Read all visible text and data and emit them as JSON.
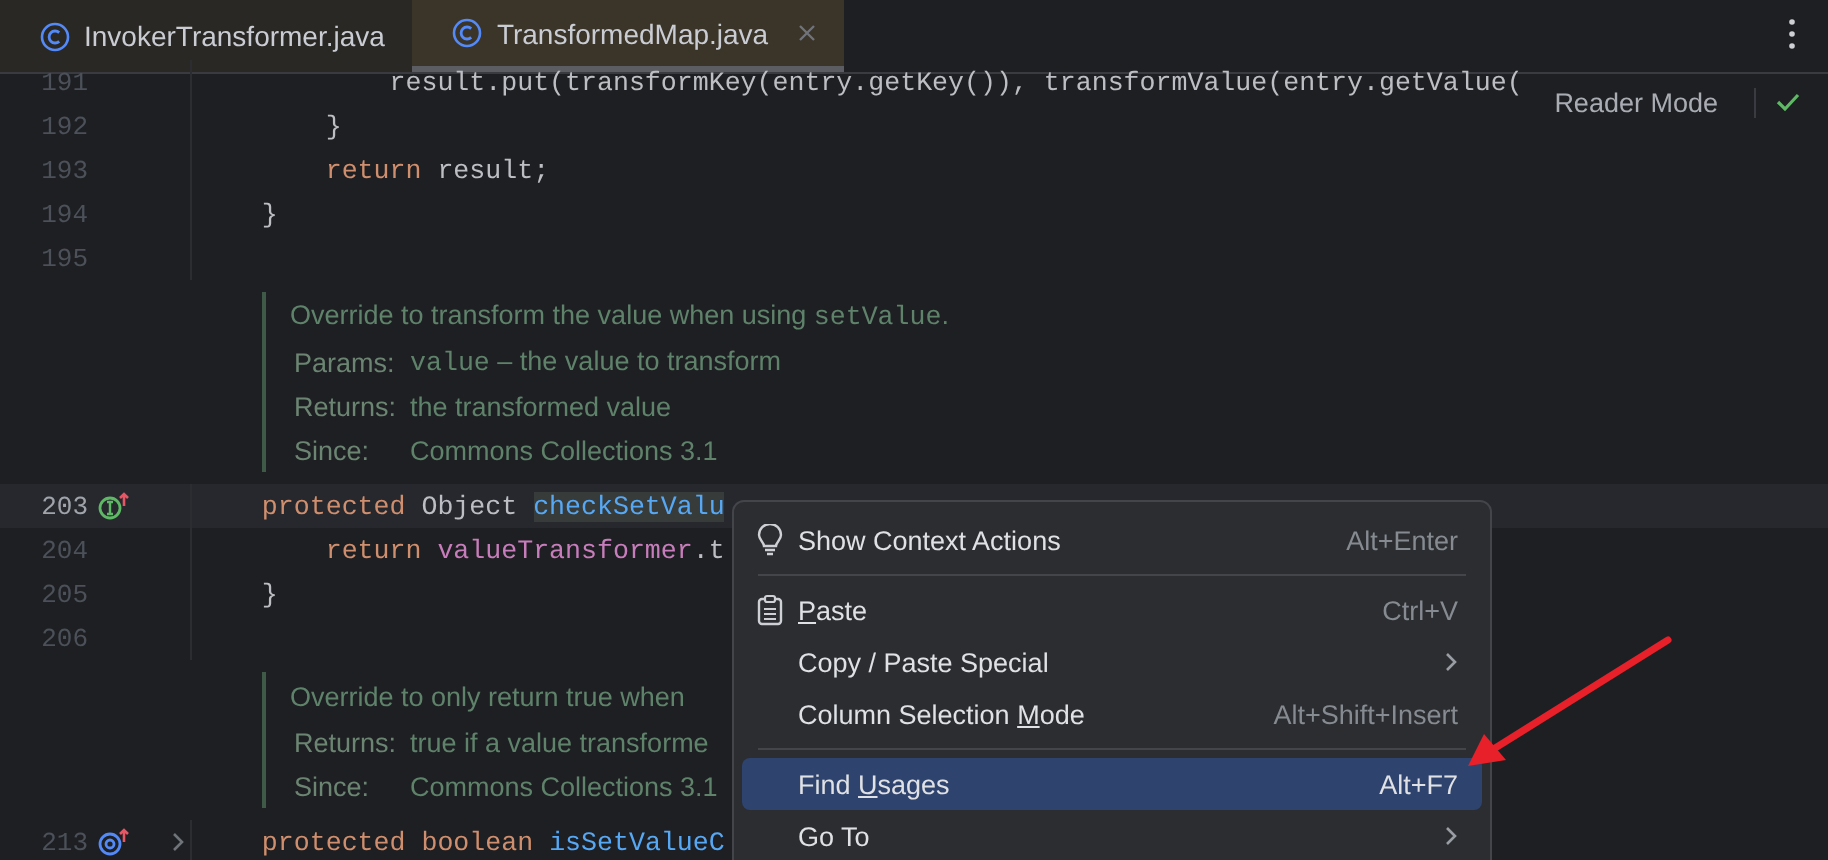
{
  "tabs": [
    {
      "label": "InvokerTransformer.java",
      "selected": false,
      "closable": false
    },
    {
      "label": "TransformedMap.java",
      "selected": true,
      "closable": true
    }
  ],
  "reader_mode": {
    "label": "Reader Mode"
  },
  "editor": {
    "lines": [
      {
        "kind": "code",
        "number": "191",
        "current": false,
        "tokens": [
          {
            "text": "            result.put(transformKey(entry.getKey()), transformValue(entry.getValue("
          }
        ]
      },
      {
        "kind": "code",
        "number": "192",
        "current": false,
        "tokens": [
          {
            "text": "        }"
          }
        ]
      },
      {
        "kind": "code",
        "number": "193",
        "current": false,
        "tokens": [
          {
            "text": "        return",
            "kind": "keyword"
          },
          {
            "text": " result;"
          }
        ]
      },
      {
        "kind": "code",
        "number": "194",
        "current": false,
        "tokens": [
          {
            "text": "    }"
          }
        ]
      },
      {
        "kind": "code",
        "number": "195",
        "current": false
      },
      {
        "kind": "doc",
        "rows": [
          {
            "kind": "summary",
            "parts": [
              {
                "text": "Override to transform the value when using "
              },
              {
                "text": "setValue",
                "kind": "code"
              },
              {
                "text": "."
              }
            ]
          },
          {
            "kind": "tag",
            "tag": "Params:",
            "parts": [
              {
                "text": "value",
                "kind": "code"
              },
              {
                "text": " – the value to transform"
              }
            ]
          },
          {
            "kind": "tag",
            "tag": "Returns:",
            "parts": [
              {
                "text": "the transformed value"
              }
            ]
          },
          {
            "kind": "tag",
            "tag": "Since:",
            "parts": [
              {
                "text": "Commons Collections 3.1"
              }
            ]
          }
        ]
      },
      {
        "kind": "overriding",
        "number": "203",
        "current": true,
        "tokens": [
          {
            "text": "    protected",
            "kind": "keyword"
          },
          {
            "text": " Object "
          },
          {
            "text": "checkSetValu",
            "kind": "selection"
          }
        ]
      },
      {
        "kind": "code",
        "number": "204",
        "current": false,
        "tokens": [
          {
            "text": "        return ",
            "kind": "keyword"
          },
          {
            "text": "valueTransformer",
            "kind": "field"
          },
          {
            "text": ".t"
          }
        ]
      },
      {
        "kind": "code",
        "number": "205",
        "current": false,
        "tokens": [
          {
            "text": "    }"
          }
        ]
      },
      {
        "kind": "code",
        "number": "206",
        "current": false
      },
      {
        "kind": "doc",
        "rows": [
          {
            "kind": "summary",
            "parts": [
              {
                "text": "Override to only return true when"
              }
            ]
          },
          {
            "kind": "tag",
            "tag": "Returns:",
            "parts": [
              {
                "text": "true if a value transforme"
              }
            ]
          },
          {
            "kind": "tag",
            "tag": "Since:",
            "parts": [
              {
                "text": "Commons Collections 3.1"
              }
            ]
          }
        ]
      },
      {
        "kind": "implemented",
        "number": "213",
        "current": false,
        "foldable": true,
        "tokens": [
          {
            "text": "    protected boolean ",
            "kind": "keyword"
          },
          {
            "text": "isSetValueC",
            "kind": "declaration"
          }
        ]
      }
    ]
  },
  "context_menu": {
    "items": [
      {
        "kind": "intention",
        "parts": [
          {
            "text": "Show Context Actions"
          }
        ],
        "shortcut": "Alt+Enter",
        "selected": false
      },
      {
        "kind": "separator"
      },
      {
        "kind": "paste",
        "parts": [
          {
            "text": "P",
            "underline": true
          },
          {
            "text": "aste"
          }
        ],
        "shortcut": "Ctrl+V",
        "selected": false
      },
      {
        "kind": "submenu",
        "parts": [
          {
            "text": "Copy / Paste Special"
          }
        ],
        "selected": false
      },
      {
        "kind": "action",
        "parts": [
          {
            "text": "Column Selection "
          },
          {
            "text": "M",
            "underline": true
          },
          {
            "text": "ode"
          }
        ],
        "shortcut": "Alt+Shift+Insert",
        "selected": false
      },
      {
        "kind": "separator"
      },
      {
        "kind": "action",
        "parts": [
          {
            "text": "Find "
          },
          {
            "text": "U",
            "underline": true
          },
          {
            "text": "sages"
          }
        ],
        "shortcut": "Alt+F7",
        "selected": true
      },
      {
        "kind": "submenu",
        "parts": [
          {
            "text": "Go To"
          }
        ],
        "selected": false
      }
    ]
  }
}
